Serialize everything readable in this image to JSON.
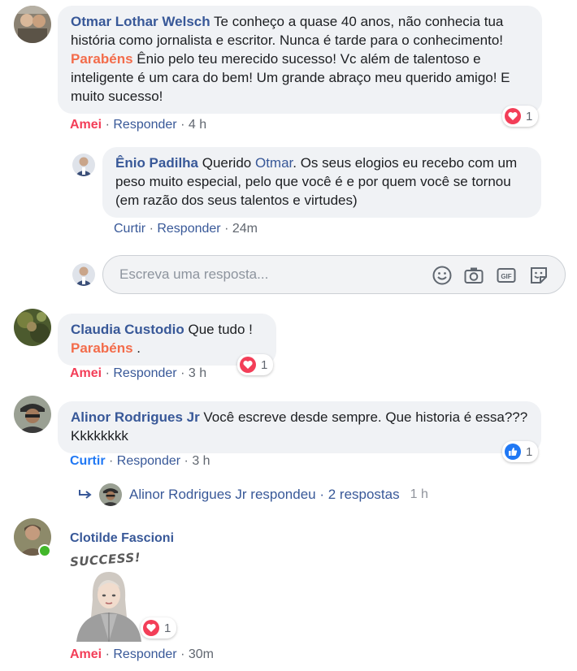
{
  "comments": [
    {
      "author": "Otmar Lothar Welsch",
      "text_part1": " Te conheço a quase 40 anos, não conhecia tua história como jornalista e escritor. Nunca é tarde para o conhecimento! ",
      "highlight": "Parabéns",
      "text_part2": " Ênio pelo teu merecido sucesso! Vc além de talentoso e inteligente é um cara do bem! Um grande abraço meu querido amigo! E muito sucesso!",
      "reaction_label": "Amei",
      "reply_label": "Responder",
      "time": "4 h",
      "reaction_count": "1"
    },
    {
      "author": "Ênio Padilha",
      "text_part1": " Querido ",
      "mention": "Otmar",
      "text_part2": ". Os seus elogios eu recebo com um peso muito especial, pelo que você é e por quem você se tornou (em razão dos seus talentos e virtudes)",
      "like_label": "Curtir",
      "reply_label": "Responder",
      "time": "24m"
    },
    {
      "author": "Claudia Custodio",
      "text_part1": " Que tudo !",
      "highlight": "Parabéns",
      "text_part2": " .",
      "reaction_label": "Amei",
      "reply_label": "Responder",
      "time": "3 h",
      "reaction_count": "1"
    },
    {
      "author": "Alinor Rodrigues Jr",
      "text_part1": " Você escreve desde sempre. Que historia é essa??? Kkkkkkkk",
      "reaction_label": "Curtir",
      "reply_label": "Responder",
      "time": "3 h",
      "reaction_count": "1",
      "replies_summary": "Alinor Rodrigues Jr respondeu · 2 respostas",
      "replies_time": "1 h"
    },
    {
      "author": "Clotilde Fascioni",
      "sticker_text": "SUCCESS!",
      "reaction_label": "Amei",
      "reply_label": "Responder",
      "time": "30m",
      "reaction_count": "1"
    }
  ],
  "reply_box": {
    "placeholder": "Escreva uma resposta..."
  },
  "dot": "·",
  "icons": [
    "love-reaction-icon",
    "like-reaction-icon",
    "emoji-icon",
    "camera-icon",
    "gif-icon",
    "sticker-icon",
    "reply-arrow-icon"
  ],
  "colors": {
    "link": "#385898",
    "love": "#f33e58",
    "like": "#2078f4",
    "bubble": "#f0f2f5",
    "online": "#42b72a"
  }
}
